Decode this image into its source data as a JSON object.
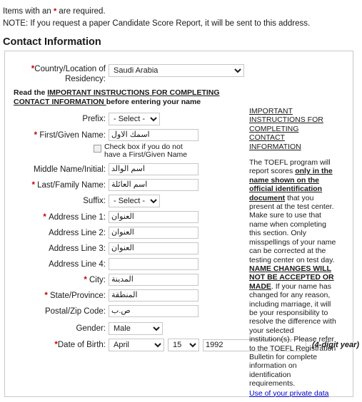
{
  "notes": {
    "line1_prefix": "Items with an ",
    "line1_star": "*",
    "line1_suffix": " are required.",
    "line2": "NOTE: If you request a paper Candidate Score Report, it will be sent to this address."
  },
  "section": {
    "title": "Contact Information"
  },
  "form": {
    "country": {
      "label": "Country/Location of Residency:",
      "label_line1": "Country/Location of",
      "label_line2": "Residency:",
      "value": "Saudi Arabia",
      "required": true
    },
    "read_instructions": {
      "prefix": "Read the ",
      "link": "IMPORTANT INSTRUCTIONS FOR COMPLETING CONTACT INFORMATION ",
      "suffix": "before entering your name"
    },
    "prefix_field": {
      "label": "Prefix:",
      "value": "- Select -",
      "required": false
    },
    "first_name": {
      "label": "First/Given Name:",
      "value": "اسمك الاول",
      "required": true
    },
    "no_first_name_checkbox": {
      "label": "Check box if you do not have a First/Given Name",
      "checked": false
    },
    "middle_name": {
      "label": "Middle Name/Initial:",
      "value": "اسم الوالد",
      "required": false
    },
    "last_name": {
      "label": "Last/Family Name:",
      "value": "اسم العائلة",
      "required": true
    },
    "suffix_field": {
      "label": "Suffix:",
      "value": "- Select -",
      "required": false
    },
    "address1": {
      "label": "Address Line 1:",
      "value": "العنوان",
      "required": true
    },
    "address2": {
      "label": "Address Line 2:",
      "value": "العنوان",
      "required": false
    },
    "address3": {
      "label": "Address Line 3:",
      "value": "العنوان",
      "required": false
    },
    "address4": {
      "label": "Address Line 4:",
      "value": "",
      "required": false
    },
    "city": {
      "label": "City:",
      "value": "المدينة",
      "required": true
    },
    "state": {
      "label": "State/Province:",
      "value": "المنطقة",
      "required": true
    },
    "postal": {
      "label": "Postal/Zip Code:",
      "value": "ص.ب",
      "required": false
    },
    "gender": {
      "label": "Gender:",
      "value": "Male",
      "required": false
    },
    "dob": {
      "label": "Date of Birth:",
      "month": "April",
      "day": "15",
      "year": "1992",
      "year_hint": "(4-digit year)",
      "required": true
    }
  },
  "sidebar": {
    "heading": "IMPORTANT INSTRUCTIONS FOR COMPLETING CONTACT INFORMATION",
    "body_part1": "The TOEFL program will report scores ",
    "body_bold1": "only in the name shown on the official identification document",
    "body_part2": " that you present at the test center. Make sure to use that name when completing this section. Only misspellings of your name can be corrected at the testing center on test day. ",
    "body_bold2": "NAME CHANGES WILL NOT BE ACCEPTED OR MADE",
    "body_part3": ". If your name has changed for any reason, including marriage, it will be your responsibility to resolve the difference with your selected institution(s). Please refer to the TOEFL Registration Bulletin for complete information on identification requirements.",
    "privacy_link": "Use of your private data"
  },
  "colors": {
    "required_star": "#cc0000",
    "link": "#0000cc",
    "panel_border": "#c8c8c8",
    "input_border": "#c6c6c6"
  }
}
